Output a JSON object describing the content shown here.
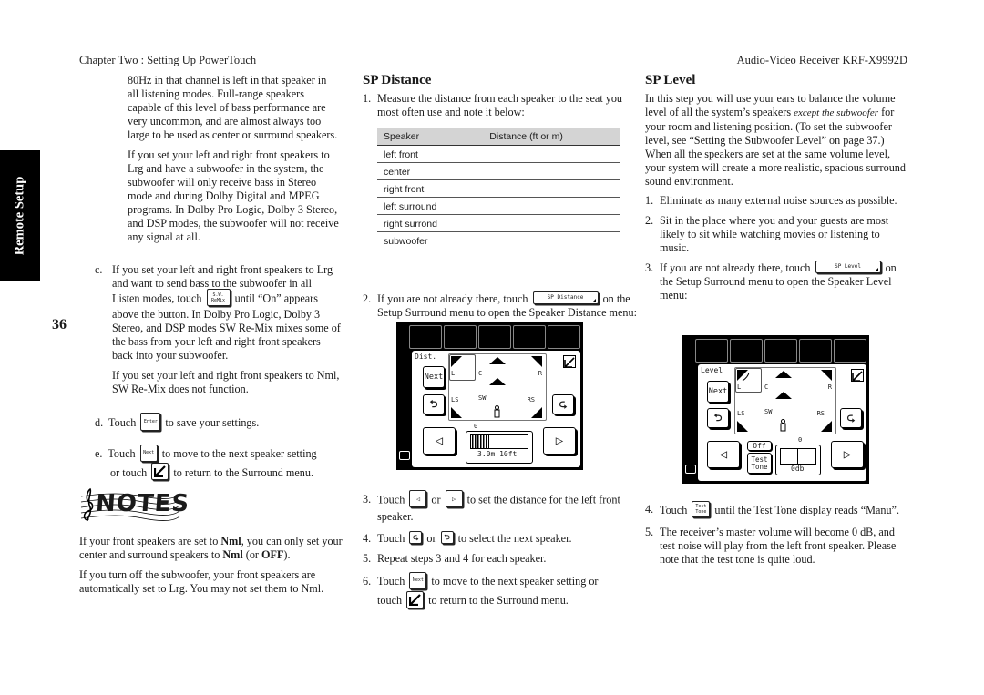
{
  "header": {
    "left": "Chapter Two : Setting Up PowerTouch",
    "right": "Audio-Video Receiver KRF-X9992D"
  },
  "side_tab": "Remote Setup",
  "page_number": "36",
  "col1": {
    "p1": "80Hz in that channel is left in that speaker in all listening modes. Full-range speakers capable of this level of bass performance are very uncommon, and are almost always too large to be used as center or surround speakers.",
    "p2": "If you set your left and right front speakers to Lrg and have a subwoofer in the system, the subwoofer will only receive bass in Stereo mode and during Dolby Digital and MPEG programs. In Dolby Pro Logic, Dolby 3 Stereo, and DSP modes, the subwoofer will not receive any signal at all.",
    "c_marker": "c.",
    "c_text_a": "If you set your left and right front speakers to Lrg and want to send bass to the subwoofer in all Listen modes, touch",
    "c_button": "S.W. ReMix",
    "c_text_b": "until “On” appears above the button. In Dolby Pro Logic, Dolby 3 Stereo, and DSP modes SW Re-Mix mixes some of the bass from your left and right front speakers back into your subwoofer.",
    "c_p2": "If you set your left and right front speakers to Nml, SW Re-Mix does not function.",
    "d_marker": "d.",
    "d_a": "Touch",
    "d_button": "Enter",
    "d_b": "to save your settings.",
    "e_marker": "e.",
    "e_a": "Touch",
    "e_button": "Next",
    "e_b": "to move to the next speaker setting",
    "e_c": "or touch",
    "e_d": "to return to the Surround menu.",
    "notes_title": "NOTES",
    "note1_a": "If your front speakers are set to ",
    "note1_b": "Nml",
    "note1_c": ", you can only set your center and surround speakers to ",
    "note1_d": "Nml",
    "note1_e": " (or ",
    "note1_f": "OFF",
    "note1_g": ").",
    "note2": "If you turn off the subwoofer, your front speakers are automatically set to Lrg. You may not set them to Nml."
  },
  "col2": {
    "title": "SP Distance",
    "step1_n": "1.",
    "step1": "Measure the distance from each speaker to the seat you most often use and note it below:",
    "table": {
      "headers": [
        "Speaker",
        "Distance (ft or m)"
      ],
      "rows": [
        [
          "left front",
          ""
        ],
        [
          "center",
          ""
        ],
        [
          "right front",
          ""
        ],
        [
          "left surround",
          ""
        ],
        [
          "right surrond",
          ""
        ],
        [
          "subwoofer",
          ""
        ]
      ]
    },
    "step2_n": "2.",
    "step2_a": "If you are not already there, touch",
    "step2_button": "SP Distance",
    "step2_b": "on the Setup Surround menu to open the Speaker Distance menu:",
    "screen": {
      "title": "Dist.",
      "next": "Next",
      "labels": {
        "L": "L",
        "C": "C",
        "R": "R",
        "LS": "LS",
        "SW": "SW",
        "RS": "RS"
      },
      "scale_zero": "0",
      "readout": "3.0m 10ft",
      "bar_fraction": 0.3
    },
    "step3_n": "3.",
    "step3_a": "Touch",
    "step3_or": "or",
    "step3_b": "to set the distance for the left front speaker.",
    "step4_n": "4.",
    "step4_a": "Touch",
    "step4_or": "or",
    "step4_b": "to select the next speaker.",
    "step5_n": "5.",
    "step5": "Repeat steps 3 and 4 for each speaker.",
    "step6_n": "6.",
    "step6_a": "Touch",
    "step6_button": "Next",
    "step6_b": "to move to the next speaker setting or",
    "step6_c": "touch",
    "step6_d": "to return to the Surround menu."
  },
  "col3": {
    "title": "SP Level",
    "intro_a": "In this step you will use your ears to balance the volume level of all the system’s speakers ",
    "intro_em": "except the subwoofer",
    "intro_b": " for your room and listening position. (To set the subwoofer level, see “Setting the Subwoofer Level” on page 37.) When all the speakers are set at the same volume level, your system will create a more realistic, spacious surround sound environment.",
    "step1_n": "1.",
    "step1": "Eliminate as many external noise sources as possible.",
    "step2_n": "2.",
    "step2": "Sit in the place where you and your guests are most likely to sit while watching movies or listening to music.",
    "step3_n": "3.",
    "step3_a": "If you are not already there, touch",
    "step3_button": "SP Level",
    "step3_b": "on the Setup Surround menu to open the Speaker Level menu:",
    "screen": {
      "title": "Level",
      "next": "Next",
      "labels": {
        "L": "L",
        "C": "C",
        "R": "R",
        "LS": "LS",
        "SW": "SW",
        "RS": "RS"
      },
      "scale_zero": "0",
      "off": "Off",
      "test_tone": "Test Tone",
      "readout": "0db"
    },
    "step4_n": "4.",
    "step4_a": "Touch",
    "step4_button": "Test Tone",
    "step4_b": "until the Test Tone display reads “Manu”.",
    "step5_n": "5.",
    "step5": "The receiver’s master volume will become 0 dB, and test noise will play from the left front speaker. Please note that the test tone is quite loud."
  }
}
